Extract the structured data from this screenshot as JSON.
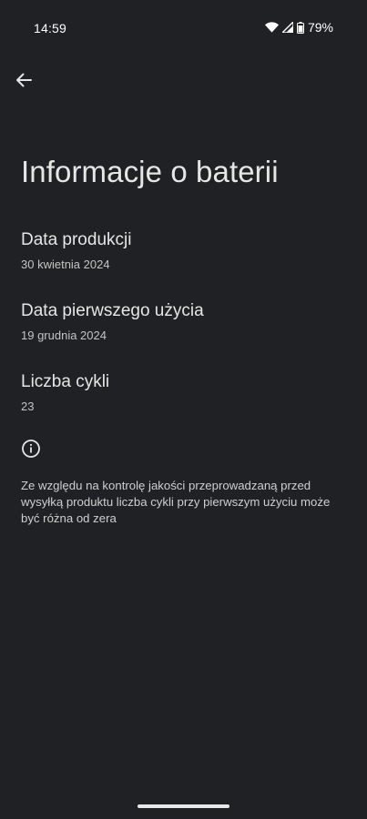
{
  "status_bar": {
    "time": "14:59",
    "battery_percent": "79%",
    "icons": [
      "wifi-icon",
      "signal-icon",
      "battery-icon"
    ]
  },
  "toolbar": {
    "back_icon": "arrow-left-icon"
  },
  "page": {
    "title": "Informacje o baterii"
  },
  "items": [
    {
      "title": "Data produkcji",
      "value": "30 kwietnia 2024"
    },
    {
      "title": "Data pierwszego użycia",
      "value": "19 grudnia 2024"
    },
    {
      "title": "Liczba cykli",
      "value": "23"
    }
  ],
  "footer": {
    "icon": "info-icon",
    "text": "Ze względu na kontrolę jakości przeprowadzaną przed wysyłką produktu liczba cykli przy pierwszym użyciu może być różna od zera"
  },
  "colors": {
    "background": "#202124",
    "text_primary": "#e6e6e6",
    "text_secondary": "#c4c4c4"
  }
}
